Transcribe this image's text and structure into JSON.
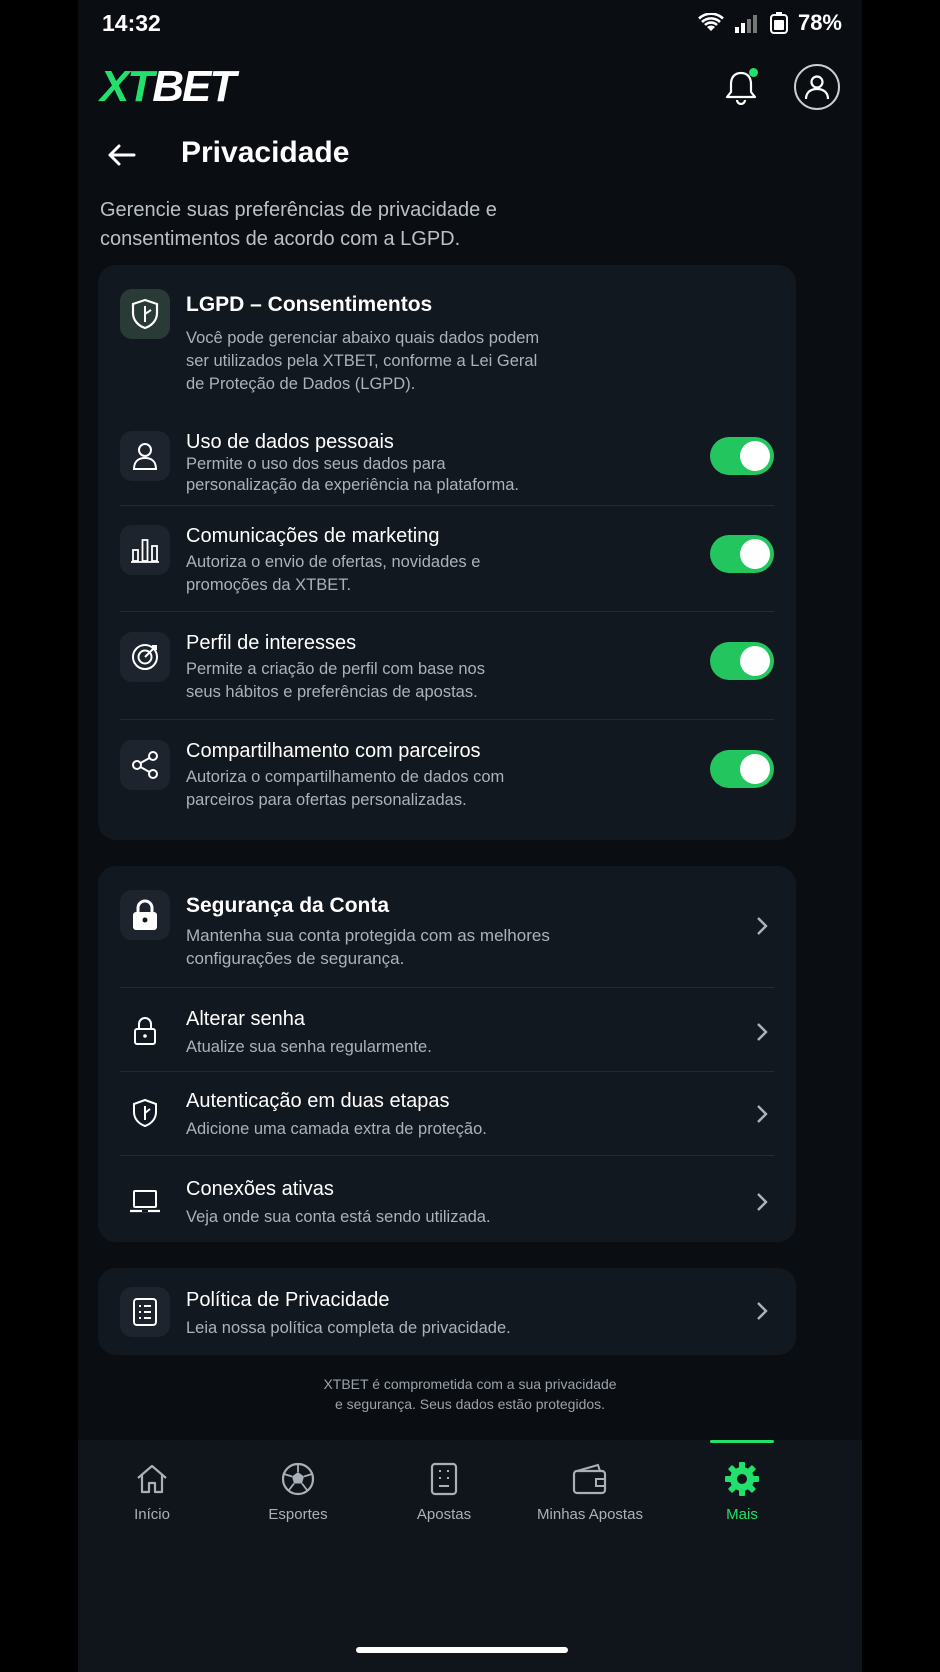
{
  "status_bar": {
    "time": "14:32",
    "battery": "78%"
  },
  "header": {
    "brand_x": "XT",
    "brand_rest": "BET"
  },
  "page": {
    "title": "Privacidade",
    "intro": "Gerencie suas preferências de privacidade e consentimentos de acordo com a LGPD."
  },
  "lgpd": {
    "title": "LGPD – Consentimentos",
    "description": "Você pode gerenciar abaixo quais dados podem ser utilizados pela XTBET, conforme a Lei Geral de Proteção de Dados (LGPD).",
    "items": [
      {
        "title": "Uso de dados pessoais",
        "desc": "Permite o uso dos seus dados para personalização da experiência na plataforma.",
        "enabled": true
      },
      {
        "title": "Comunicações de marketing",
        "desc": "Autoriza o envio de ofertas, novidades e promoções da XTBET.",
        "enabled": true
      },
      {
        "title": "Perfil de interesses",
        "desc": "Permite a criação de perfil com base nos seus hábitos e preferências de apostas.",
        "enabled": true
      },
      {
        "title": "Compartilhamento com parceiros",
        "desc": "Autoriza o compartilhamento de dados com parceiros para ofertas personalizadas.",
        "enabled": true
      }
    ]
  },
  "security": {
    "title": "Segurança da Conta",
    "description": "Mantenha sua conta protegida com as melhores configurações de segurança.",
    "items": [
      {
        "title": "Alterar senha",
        "desc": "Atualize sua senha regularmente."
      },
      {
        "title": "Autenticação em duas etapas",
        "desc": "Adicione uma camada extra de proteção."
      },
      {
        "title": "Conexões ativas",
        "desc": "Veja onde sua conta está sendo utilizada."
      }
    ]
  },
  "policy": {
    "title": "Política de Privacidade",
    "desc": "Leia nossa política completa de privacidade."
  },
  "footer_note": {
    "line1": "XTBET é comprometida com a sua privacidade",
    "line2": "e segurança. Seus dados estão protegidos."
  },
  "tabs": [
    {
      "label": "Início",
      "icon": "home-icon"
    },
    {
      "label": "Esportes",
      "icon": "soccer-ball-icon"
    },
    {
      "label": "Apostas",
      "icon": "ticket-icon"
    },
    {
      "label": "Minhas Apostas",
      "icon": "wallet-icon"
    },
    {
      "label": "Mais",
      "icon": "gear-icon",
      "active": true
    }
  ],
  "colors": {
    "accent": "#22e06b",
    "toggle_on": "#22c55e",
    "background": "#0a0e12",
    "card": "#121820"
  }
}
